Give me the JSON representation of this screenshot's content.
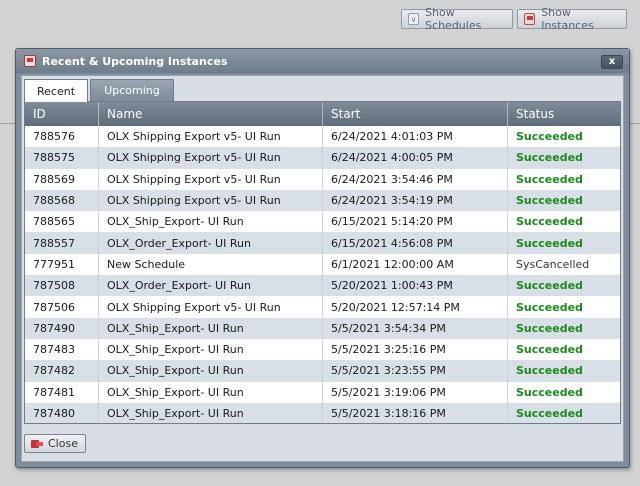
{
  "toolbar": {
    "show_schedules_label": "Show Schedules",
    "show_instances_label": "Show Instances"
  },
  "dialog": {
    "title": "Recent & Upcoming Instances",
    "close_x": "x",
    "tabs": [
      {
        "label": "Recent",
        "active": true
      },
      {
        "label": "Upcoming",
        "active": false
      }
    ],
    "close_button_label": "Close"
  },
  "table": {
    "columns": [
      "ID",
      "Name",
      "Start",
      "Status"
    ],
    "rows": [
      {
        "id": "788576",
        "name": "OLX Shipping Export v5- UI Run",
        "start": "6/24/2021 4:01:03 PM",
        "status": "Succeeded"
      },
      {
        "id": "788575",
        "name": "OLX Shipping Export v5- UI Run",
        "start": "6/24/2021 4:00:05 PM",
        "status": "Succeeded"
      },
      {
        "id": "788569",
        "name": "OLX Shipping Export v5- UI Run",
        "start": "6/24/2021 3:54:46 PM",
        "status": "Succeeded"
      },
      {
        "id": "788568",
        "name": "OLX Shipping Export v5- UI Run",
        "start": "6/24/2021 3:54:19 PM",
        "status": "Succeeded"
      },
      {
        "id": "788565",
        "name": "OLX_Ship_Export- UI Run",
        "start": "6/15/2021 5:14:20 PM",
        "status": "Succeeded"
      },
      {
        "id": "788557",
        "name": "OLX_Order_Export- UI Run",
        "start": "6/15/2021 4:56:08 PM",
        "status": "Succeeded"
      },
      {
        "id": "777951",
        "name": "New Schedule",
        "start": "6/1/2021 12:00:00 AM",
        "status": "SysCancelled"
      },
      {
        "id": "787508",
        "name": "OLX_Order_Export- UI Run",
        "start": "5/20/2021 1:00:43 PM",
        "status": "Succeeded"
      },
      {
        "id": "787506",
        "name": "OLX Shipping Export v5- UI Run",
        "start": "5/20/2021 12:57:14 PM",
        "status": "Succeeded"
      },
      {
        "id": "787490",
        "name": "OLX_Ship_Export- UI Run",
        "start": "5/5/2021 3:54:34 PM",
        "status": "Succeeded"
      },
      {
        "id": "787483",
        "name": "OLX_Ship_Export- UI Run",
        "start": "5/5/2021 3:25:16 PM",
        "status": "Succeeded"
      },
      {
        "id": "787482",
        "name": "OLX_Ship_Export- UI Run",
        "start": "5/5/2021 3:23:55 PM",
        "status": "Succeeded"
      },
      {
        "id": "787481",
        "name": "OLX_Ship_Export- UI Run",
        "start": "5/5/2021 3:19:06 PM",
        "status": "Succeeded"
      },
      {
        "id": "787480",
        "name": "OLX_Ship_Export- UI Run",
        "start": "5/5/2021 3:18:16 PM",
        "status": "Succeeded"
      }
    ]
  }
}
